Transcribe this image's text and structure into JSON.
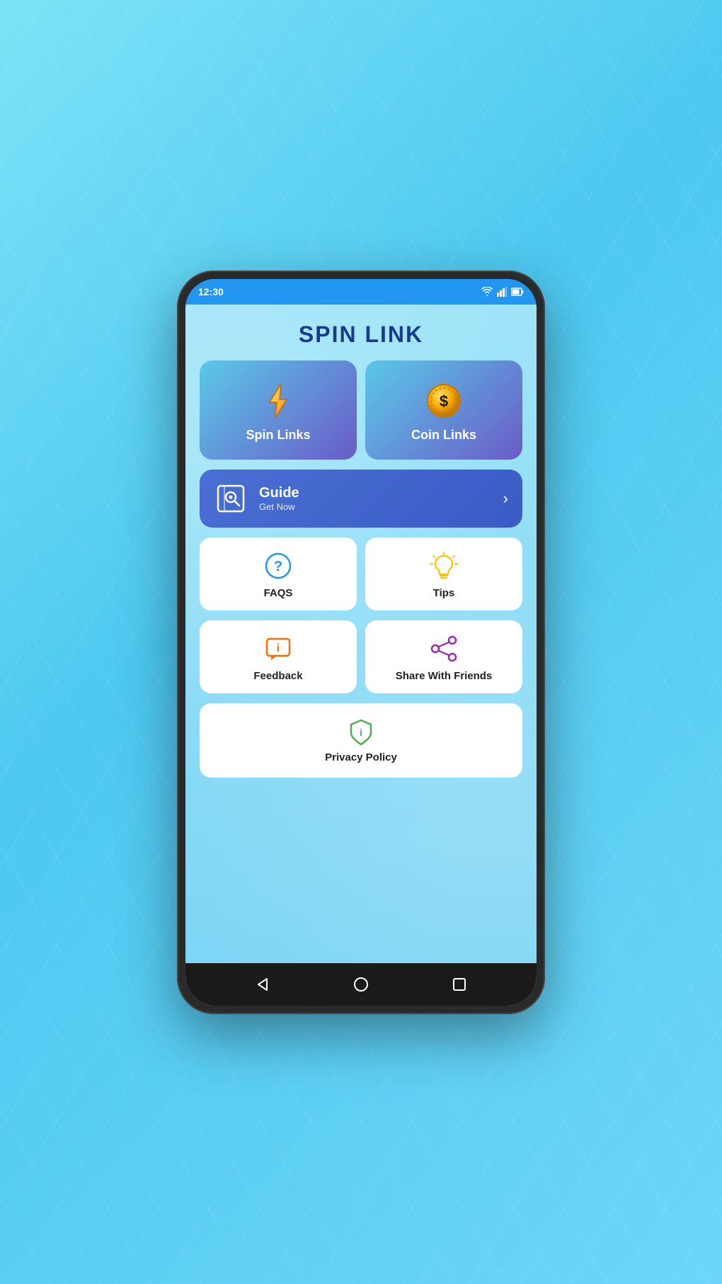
{
  "statusBar": {
    "time": "12:30",
    "icons": [
      "wifi",
      "signal",
      "battery"
    ]
  },
  "appTitle": "SPIN LINK",
  "topCards": [
    {
      "id": "spin-links",
      "label": "Spin Links",
      "icon": "lightning"
    },
    {
      "id": "coin-links",
      "label": "Coin Links",
      "icon": "coin"
    }
  ],
  "guideBanner": {
    "title": "Guide",
    "subtitle": "Get Now",
    "icon": "book"
  },
  "menuItems": [
    {
      "id": "faqs",
      "label": "FAQS",
      "icon": "faqs"
    },
    {
      "id": "tips",
      "label": "Tips",
      "icon": "tips"
    },
    {
      "id": "feedback",
      "label": "Feedback",
      "icon": "feedback"
    },
    {
      "id": "share",
      "label": "Share With Friends",
      "icon": "share"
    }
  ],
  "privacyPolicy": {
    "label": "Privacy Policy",
    "icon": "shield"
  },
  "bottomNav": {
    "back": "◁",
    "home": "○",
    "recent": "□"
  }
}
